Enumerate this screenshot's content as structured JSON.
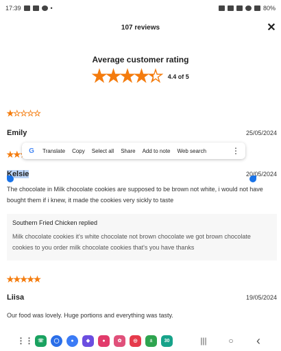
{
  "status_bar": {
    "time": "17:39",
    "battery": "80%",
    "dot": "•"
  },
  "header": {
    "title": "107 reviews",
    "close_label": "✕"
  },
  "summary": {
    "title": "Average customer rating",
    "value_text": "4.4 of 5",
    "rating": 4.4,
    "stars": "★★★★★"
  },
  "reviews": [
    {
      "name": "Emily",
      "date": "25/05/2024",
      "rating": 1,
      "stars": "★★★★★"
    },
    {
      "name": "Kelsie",
      "date": "20/05/2024",
      "rating": 3,
      "stars": "★★★★★",
      "text": "The chocolate in Milk chocolate cookies are supposed to be brown not white, i would not have bought them if i knew, it made the cookies very sickly to taste",
      "reply": {
        "header": "Southern Fried Chicken replied",
        "text": "Milk chocolate cookies it's white chocolate not brown chocolate we got brown chocolate cookies to you order milk chocolate cookies that's you have thanks"
      }
    },
    {
      "name": "Liisa",
      "date": "19/05/2024",
      "rating": 5,
      "stars": "★★★★★",
      "text": "Our food was lovely. Huge portions and everything was tasty."
    }
  ],
  "context_menu": {
    "translate": "Translate",
    "copy": "Copy",
    "select_all": "Select all",
    "share": "Share",
    "add_to_note": "Add to note",
    "web_search": "Web search",
    "more": "⋮",
    "google": "G"
  },
  "nav": {
    "recents": "|||",
    "home": "○",
    "back": "‹"
  },
  "colors": {
    "star": "#f47c0e",
    "selection": "#bcd4f6",
    "handle": "#1a73e8"
  },
  "icons": [
    "apps-grid-icon",
    "phone-icon",
    "signal-icon",
    "messages-icon",
    "galaxy-store-icon",
    "browser-icon",
    "flower-icon",
    "camera-icon",
    "calculator-icon",
    "calendar-icon"
  ]
}
